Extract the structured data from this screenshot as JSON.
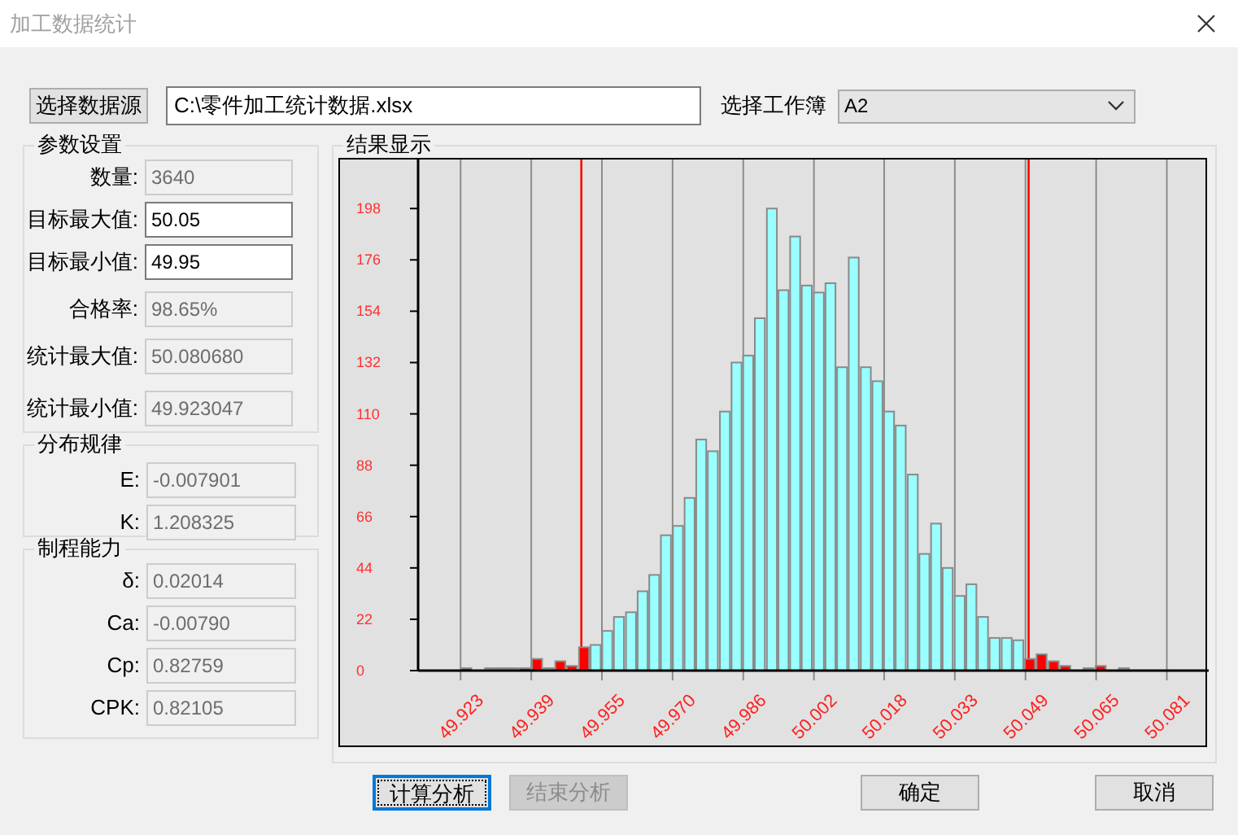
{
  "window": {
    "title": "加工数据统计"
  },
  "data_source": {
    "button": "选择数据源",
    "path": "C:\\零件加工统计数据.xlsx",
    "sheet_label": "选择工作簿",
    "sheet": "A2"
  },
  "groups": [
    {
      "title": "参数设置",
      "fields": [
        {
          "label": "数量:",
          "value": "3640",
          "disabled": true
        },
        {
          "label": "目标最大值:",
          "value": "50.05",
          "disabled": false
        },
        {
          "label": "目标最小值:",
          "value": "49.95",
          "disabled": false
        },
        {
          "label": "合格率:",
          "value": "98.65%",
          "disabled": true
        },
        {
          "label": "统计最大值:",
          "value": "50.080680",
          "disabled": true
        },
        {
          "label": "统计最小值:",
          "value": "49.923047",
          "disabled": true
        }
      ]
    },
    {
      "title": "分布规律",
      "fields": [
        {
          "label": "E:",
          "value": "-0.007901",
          "disabled": true
        },
        {
          "label": "K:",
          "value": "1.208325",
          "disabled": true
        }
      ]
    },
    {
      "title": "制程能力",
      "fields": [
        {
          "label": "δ:",
          "value": "0.02014",
          "disabled": true
        },
        {
          "label": "Ca:",
          "value": "-0.00790",
          "disabled": true
        },
        {
          "label": "Cp:",
          "value": "0.82759",
          "disabled": true
        },
        {
          "label": "CPK:",
          "value": "0.82105",
          "disabled": true
        }
      ]
    }
  ],
  "result": {
    "title": "结果显示",
    "chart_data": {
      "type": "bar",
      "x": [
        49.9243,
        49.9269,
        49.9296,
        49.9322,
        49.9348,
        49.9374,
        49.9401,
        49.9427,
        49.9453,
        49.9479,
        49.9506,
        49.9532,
        49.9558,
        49.9584,
        49.9611,
        49.9637,
        49.9663,
        49.9689,
        49.9716,
        49.9742,
        49.9768,
        49.9794,
        49.9821,
        49.9847,
        49.9873,
        49.9899,
        49.9926,
        49.9952,
        49.9978,
        50.0004,
        50.0031,
        50.0057,
        50.0083,
        50.0109,
        50.0136,
        50.0162,
        50.0188,
        50.0214,
        50.0241,
        50.0267,
        50.0293,
        50.0319,
        50.0346,
        50.0372,
        50.0398,
        50.0424,
        50.0451,
        50.0477,
        50.0503,
        50.0529,
        50.0556,
        50.0582,
        50.0608,
        50.0634,
        50.0661,
        50.0687,
        50.0713
      ],
      "series": [
        {
          "color": "#99ffff",
          "values": [
            null,
            null,
            null,
            null,
            null,
            null,
            null,
            null,
            null,
            null,
            null,
            11,
            17,
            23,
            25,
            34,
            41,
            58,
            62,
            74,
            99,
            94,
            111,
            132,
            135,
            151,
            198,
            163,
            186,
            165,
            162,
            166,
            130,
            177,
            130,
            124,
            111,
            105,
            84,
            50,
            63,
            44,
            32,
            37,
            23,
            14,
            14,
            13,
            null,
            null,
            null,
            null,
            null,
            null,
            null,
            null,
            null
          ]
        },
        {
          "color": "#ff0000",
          "values": [
            1,
            null,
            null,
            null,
            null,
            1,
            5,
            null,
            4,
            2,
            10,
            null,
            null,
            null,
            null,
            null,
            null,
            null,
            null,
            null,
            null,
            null,
            null,
            null,
            null,
            null,
            null,
            null,
            null,
            null,
            null,
            null,
            null,
            null,
            null,
            null,
            null,
            null,
            null,
            null,
            null,
            null,
            null,
            null,
            null,
            null,
            null,
            null,
            5,
            7,
            4,
            2,
            null,
            null,
            2,
            null,
            null
          ]
        },
        {
          "color": "#a0a0a0",
          "values": [
            null,
            null,
            0,
            0,
            0,
            null,
            null,
            0,
            null,
            null,
            null,
            null,
            null,
            null,
            null,
            null,
            null,
            null,
            null,
            null,
            null,
            null,
            null,
            null,
            null,
            null,
            null,
            null,
            null,
            null,
            null,
            null,
            null,
            null,
            null,
            null,
            null,
            null,
            null,
            null,
            null,
            null,
            null,
            null,
            null,
            null,
            null,
            null,
            null,
            null,
            null,
            null,
            null,
            0,
            null,
            null,
            0
          ]
        }
      ],
      "xlim": [
        49.9135,
        50.0899
      ],
      "ylim": [
        0,
        219
      ],
      "yticks": [
        0,
        22,
        44,
        66,
        88,
        110,
        132,
        154,
        176,
        198
      ],
      "xticks": [
        {
          "value": 49.923,
          "label": "49.923"
        },
        {
          "value": 49.9388,
          "label": "49.939"
        },
        {
          "value": 49.9546,
          "label": "49.955"
        },
        {
          "value": 49.9704,
          "label": "49.970"
        },
        {
          "value": 49.9862,
          "label": "49.986"
        },
        {
          "value": 50.002,
          "label": "50.002"
        },
        {
          "value": 50.0177,
          "label": "50.018"
        },
        {
          "value": 50.0335,
          "label": "50.033"
        },
        {
          "value": 50.0493,
          "label": "50.049"
        },
        {
          "value": 50.0651,
          "label": "50.065"
        },
        {
          "value": 50.0809,
          "label": "50.081"
        }
      ],
      "grid": true,
      "ref_lines": [
        {
          "axis": "x",
          "value": 49.95,
          "color": "#ff0000"
        },
        {
          "axis": "x",
          "value": 50.05,
          "color": "#ff0000"
        }
      ]
    }
  },
  "buttons": [
    {
      "label": "计算分析",
      "disabled": false,
      "focused": true
    },
    {
      "label": "结束分析",
      "disabled": true,
      "focused": false
    },
    {
      "label": "确定",
      "disabled": false,
      "focused": false
    },
    {
      "label": "取消",
      "disabled": false,
      "focused": false
    }
  ]
}
